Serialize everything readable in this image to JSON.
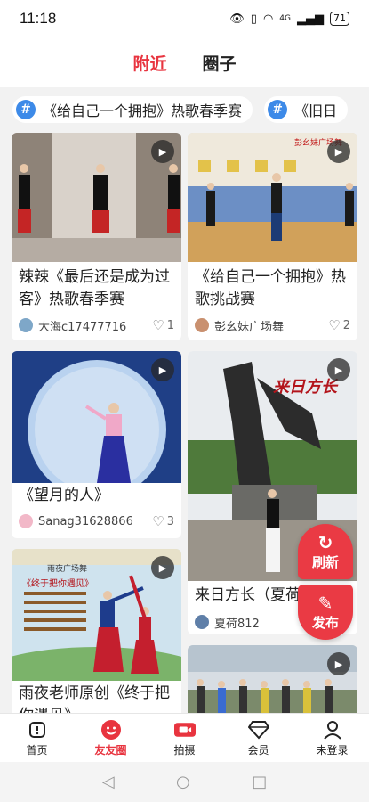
{
  "status": {
    "time": "11:18",
    "signal": "4G",
    "battery": "71"
  },
  "header": {
    "tabs": [
      {
        "label": "附近",
        "active": true
      },
      {
        "label": "圈子",
        "active": false
      }
    ]
  },
  "topics": [
    "《给自己一个拥抱》热歌春季赛",
    "《旧日"
  ],
  "cards": [
    {
      "title": "辣辣《最后还是成为过客》热歌春季赛",
      "author": "大海c17477716",
      "likes": "1"
    },
    {
      "title": "《给自己一个拥抱》热歌挑战赛",
      "author": "彭幺妹广场舞",
      "likes": "2"
    },
    {
      "title": "《望月的人》",
      "author": "Sanag31628866",
      "likes": "3"
    },
    {
      "title": "来日方长（夏荷",
      "author": "夏荷812",
      "likes": ""
    },
    {
      "title": "雨夜老师原创《终于把你遇见》",
      "author": "",
      "likes": ""
    },
    {
      "title": "",
      "author": "",
      "likes": ""
    }
  ],
  "thumb_text": {
    "card2": "彭幺妹广场舞",
    "card4": "来日方长",
    "card5_top": "雨夜广场舞",
    "card5_title": "《终于把你遇见》"
  },
  "float": {
    "refresh": "刷新",
    "publish": "发布"
  },
  "tabbar": [
    {
      "label": "首页",
      "icon": "home-icon",
      "active": false
    },
    {
      "label": "友友圈",
      "icon": "smile-icon",
      "active": true
    },
    {
      "label": "拍摄",
      "icon": "camera-icon",
      "active": false
    },
    {
      "label": "会员",
      "icon": "diamond-icon",
      "active": false
    },
    {
      "label": "未登录",
      "icon": "user-icon",
      "active": false
    }
  ],
  "colors": {
    "accent": "#e8343f",
    "topic_hash": "#3d8ae8"
  }
}
